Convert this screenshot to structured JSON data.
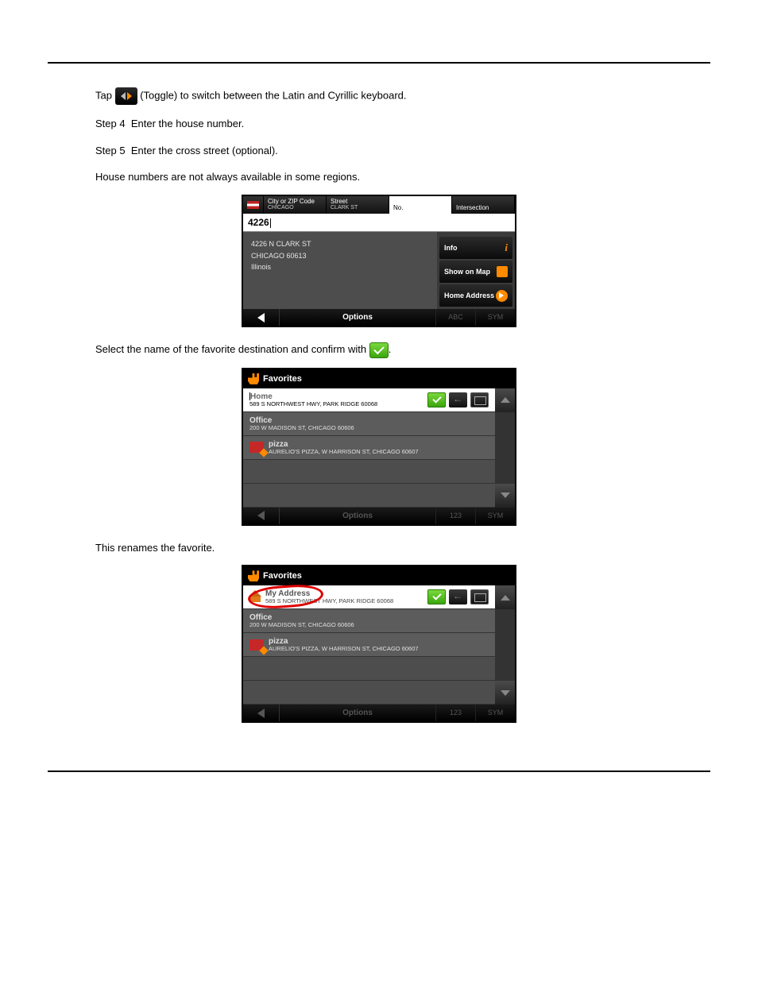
{
  "steps": {
    "pre": "Tap",
    "pre_after": "(Toggle) to switch between the Latin and Cyrillic keyboard.",
    "step4_label": "Step 4",
    "step4": "Enter the house number.",
    "step5_label": "Step 5",
    "step5": "Enter the cross street (optional).",
    "step5_note": "House numbers are not always available in some regions."
  },
  "s1": {
    "flag_label": "L",
    "tabs": {
      "city_label": "City or ZIP Code",
      "city_value": "CHICAGO",
      "street_label": "Street",
      "street_value": "CLARK ST",
      "no_label": "No.",
      "intersection": "Intersection"
    },
    "input": "4226",
    "result_line1": "4226 N CLARK ST",
    "result_line2": "CHICAGO 60613",
    "result_line3": "Illinois",
    "btn_info": "Info",
    "btn_map": "Show on Map",
    "btn_home": "Home Address",
    "footer_options": "Options",
    "kbd_abc": "ABC",
    "kbd_sym": "SYM"
  },
  "between1": {
    "text_before": "Select the name of the favorite destination and confirm with",
    "text_after": "."
  },
  "fav_title": "Favorites",
  "s2": {
    "row1_name": "Home",
    "row1_addr": "589 S NORTHWEST HWY, PARK RIDGE 60068",
    "row2_name": "Office",
    "row2_addr": "200 W MADISON ST, CHICAGO 60606",
    "row3_name": "pizza",
    "row3_addr": "AURELIO'S PIZZA, W HARRISON ST, CHICAGO 60607",
    "footer_options": "Options",
    "kbd_123": "123",
    "kbd_sym": "SYM"
  },
  "between2": "This renames the favorite.",
  "s3": {
    "row1_name": "My Address",
    "row1_addr": "589 S NORTHWEST HWY, PARK RIDGE 60068",
    "row2_name": "Office",
    "row2_addr": "200 W MADISON ST, CHICAGO 60606",
    "row3_name": "pizza",
    "row3_addr": "AURELIO'S PIZZA, W HARRISON ST, CHICAGO 60607",
    "footer_options": "Options",
    "kbd_123": "123",
    "kbd_sym": "SYM"
  }
}
